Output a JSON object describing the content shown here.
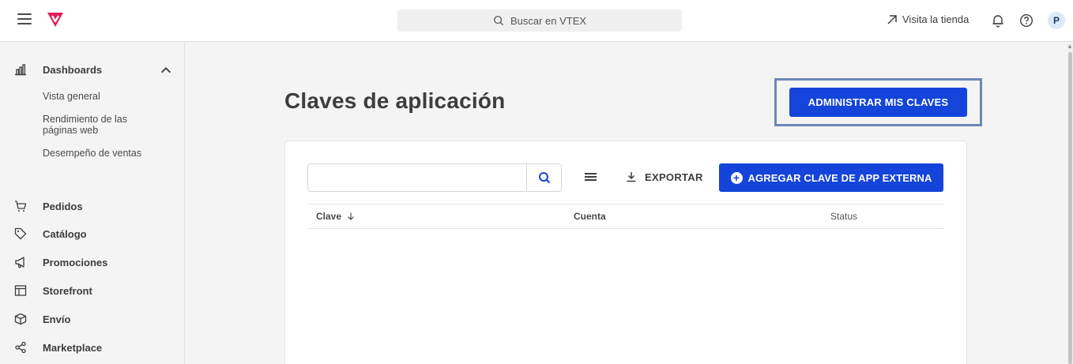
{
  "topbar": {
    "search_placeholder": "Buscar en VTEX",
    "store_link": "Visita la tienda",
    "avatar_initial": "P"
  },
  "sidebar": {
    "dashboards": {
      "label": "Dashboards",
      "sub_items": [
        "Vista general",
        "Rendimiento de las páginas web",
        "Desempeño de ventas"
      ]
    },
    "items": [
      {
        "label": "Pedidos",
        "icon": "cart-icon"
      },
      {
        "label": "Catálogo",
        "icon": "tag-icon"
      },
      {
        "label": "Promociones",
        "icon": "megaphone-icon"
      },
      {
        "label": "Storefront",
        "icon": "layout-icon"
      },
      {
        "label": "Envío",
        "icon": "box-icon"
      },
      {
        "label": "Marketplace",
        "icon": "share-icon"
      }
    ]
  },
  "main": {
    "title": "Claves de aplicación",
    "admin_button": "ADMINISTRAR MIS CLAVES",
    "toolbar": {
      "export_label": "EXPORTAR",
      "add_button": "AGREGAR CLAVE DE APP EXTERNA"
    },
    "table": {
      "columns": [
        "Clave",
        "Cuenta",
        "Status"
      ]
    }
  },
  "colors": {
    "accent": "#1444d9",
    "brand": "#e31c58",
    "highlight_border": "#6c88b6"
  }
}
